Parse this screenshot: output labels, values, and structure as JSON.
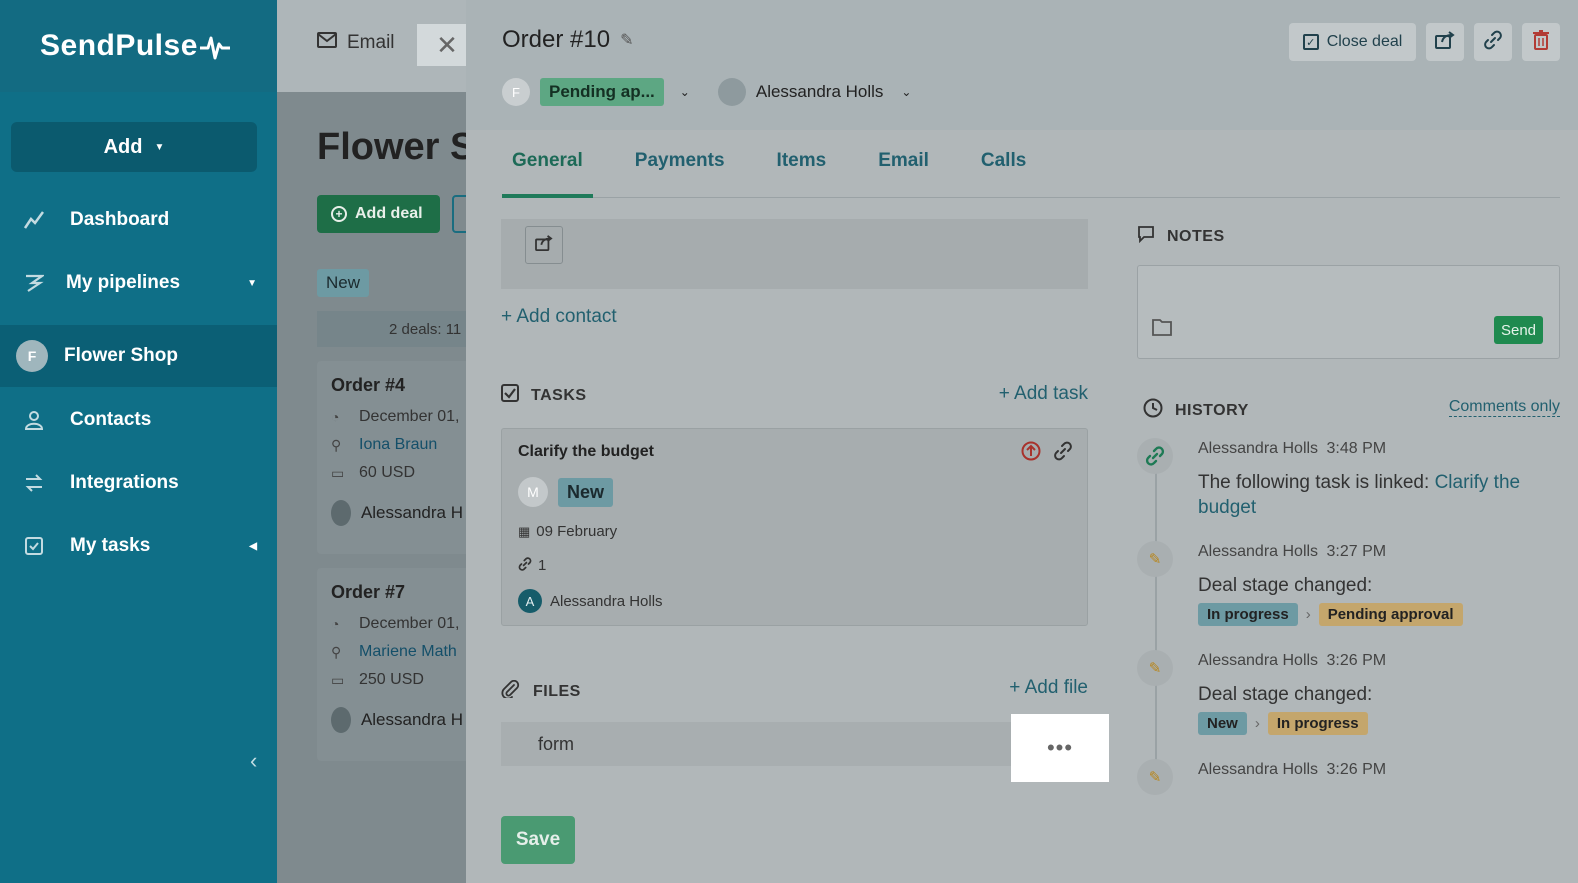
{
  "sidebar": {
    "logo": "SendPulse",
    "add_label": "Add",
    "items": [
      {
        "label": "Dashboard",
        "icon": "chart-line-icon"
      },
      {
        "label": "My pipelines",
        "icon": "pipeline-icon"
      },
      {
        "label": "Flower Shop",
        "avatar": "F"
      },
      {
        "label": "Contacts",
        "icon": "contacts-icon"
      },
      {
        "label": "Integrations",
        "icon": "integrations-icon"
      },
      {
        "label": "My tasks",
        "icon": "tasks-icon"
      }
    ]
  },
  "background_page": {
    "tab_label": "Email",
    "title": "Flower S",
    "add_deal_label": "Add deal",
    "stage_label": "New",
    "deals_summary": "2 deals: 11",
    "cards": [
      {
        "title": "Order #4",
        "date": "December 01,",
        "contact": "Iona Braun",
        "amount": "60 USD",
        "owner": "Alessandra H"
      },
      {
        "title": "Order #7",
        "date": "December 01,",
        "contact": "Mariene Math",
        "amount": "250 USD",
        "owner": "Alessandra H"
      }
    ]
  },
  "deal": {
    "title": "Order #10",
    "stage_avatar": "F",
    "stage": "Pending ap...",
    "owner": "Alessandra Holls",
    "actions": {
      "close_deal": "Close deal"
    },
    "tabs": [
      "General",
      "Payments",
      "Items",
      "Email",
      "Calls"
    ],
    "add_contact": "+ Add contact",
    "tasks": {
      "header": "TASKS",
      "add_label": "+ Add task",
      "task": {
        "title": "Clarify the budget",
        "assignee_avatar": "M",
        "status": "New",
        "date": "09 February",
        "links_count": "1",
        "owner_avatar": "A",
        "owner": "Alessandra Holls"
      }
    },
    "files": {
      "header": "FILES",
      "add_label": "+ Add file",
      "items": [
        {
          "name": "form",
          "menu": "•••"
        }
      ]
    },
    "save_label": "Save"
  },
  "notes": {
    "header": "NOTES",
    "send_label": "Send"
  },
  "history": {
    "header": "HISTORY",
    "filter_label": "Comments only",
    "items": [
      {
        "author": "Alessandra Holls",
        "time": "3:48 PM",
        "text": "The following task is linked: ",
        "link": "Clarify the budget"
      },
      {
        "author": "Alessandra Holls",
        "time": "3:27 PM",
        "text": "Deal stage changed:",
        "from": "In progress",
        "to": "Pending approval"
      },
      {
        "author": "Alessandra Holls",
        "time": "3:26 PM",
        "text": "Deal stage changed:",
        "from": "New",
        "to": "In progress"
      },
      {
        "author": "Alessandra Holls",
        "time": "3:26 PM"
      }
    ]
  },
  "colors": {
    "brand": "#0f6f87",
    "accent_green": "#1f7a5a",
    "link": "#22606f"
  }
}
